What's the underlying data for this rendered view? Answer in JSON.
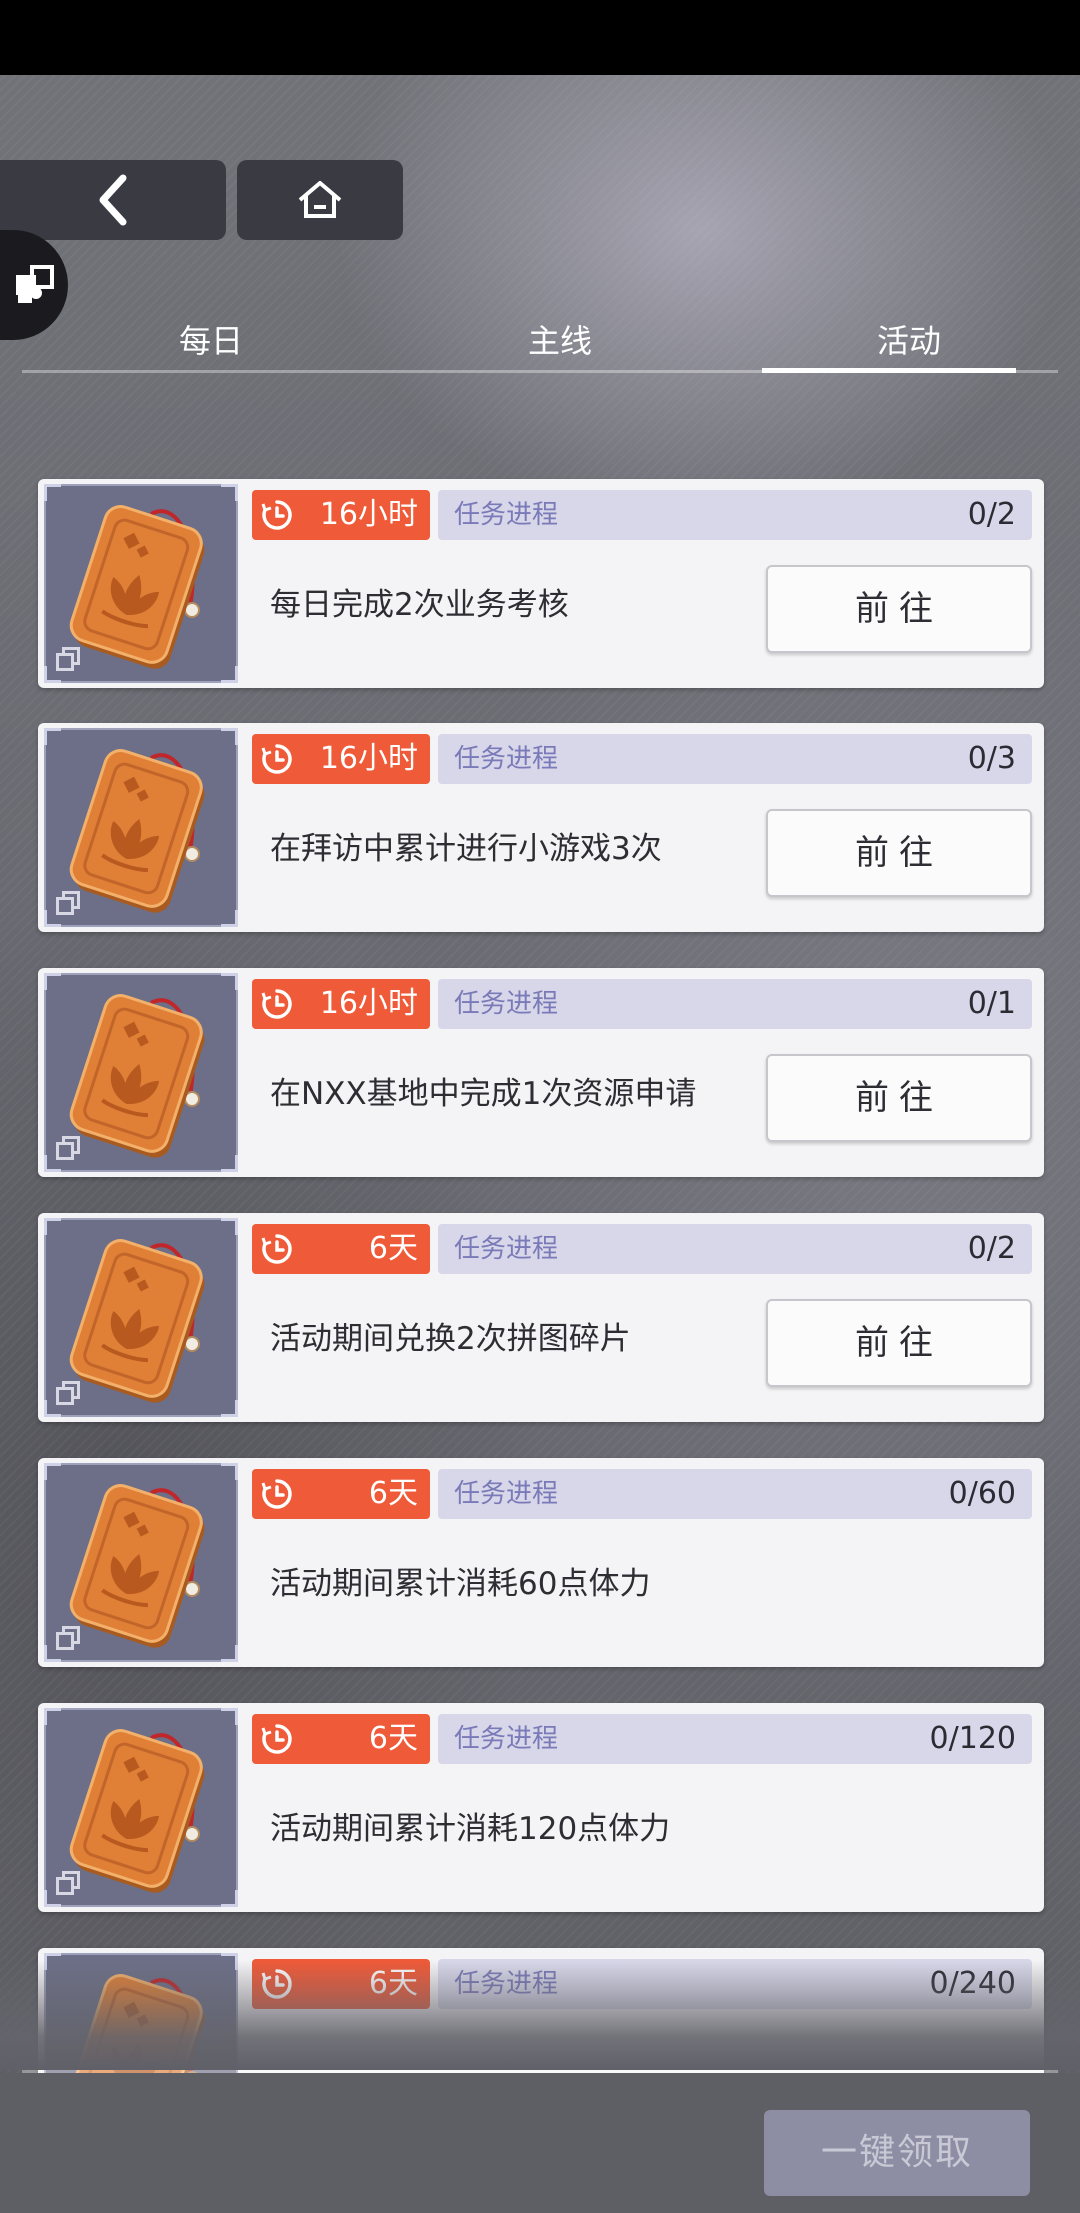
{
  "nav": {
    "back_icon": "chevron-left-icon",
    "home_icon": "home-icon",
    "side_icon": "puzzle-icon"
  },
  "tabs": [
    {
      "label": "每日",
      "active": false
    },
    {
      "label": "主线",
      "active": false
    },
    {
      "label": "活动",
      "active": true
    }
  ],
  "tasks": [
    {
      "time": "16小时",
      "progress_label": "任务进程",
      "progress": "0/2",
      "desc": "每日完成2次业务考核",
      "button": "前往"
    },
    {
      "time": "16小时",
      "progress_label": "任务进程",
      "progress": "0/3",
      "desc": "在拜访中累计进行小游戏3次",
      "button": "前往"
    },
    {
      "time": "16小时",
      "progress_label": "任务进程",
      "progress": "0/1",
      "desc": "在NXX基地中完成1次资源申请",
      "button": "前往"
    },
    {
      "time": "6天",
      "progress_label": "任务进程",
      "progress": "0/2",
      "desc": "活动期间兑换2次拼图碎片",
      "button": "前往"
    },
    {
      "time": "6天",
      "progress_label": "任务进程",
      "progress": "0/60",
      "desc": "活动期间累计消耗60点体力",
      "button": ""
    },
    {
      "time": "6天",
      "progress_label": "任务进程",
      "progress": "0/120",
      "desc": "活动期间累计消耗120点体力",
      "button": ""
    },
    {
      "time": "6天",
      "progress_label": "任务进程",
      "progress": "0/240",
      "desc": "",
      "button": ""
    }
  ],
  "footer": {
    "collect_all_label": "一键领取"
  },
  "colors": {
    "timer": "#ef5a38",
    "progress_bg": "#d7d7e9",
    "progress_label": "#7a7ab8",
    "card_bg": "#f4f4f6"
  }
}
